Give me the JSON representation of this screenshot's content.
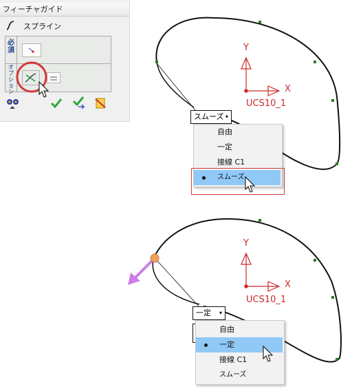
{
  "guide": {
    "title": "フィーチャガイド",
    "feature_label": "スプライン",
    "section_required": "必須",
    "section_option": "オプション"
  },
  "canvas1": {
    "combo_value": "スムーズ",
    "menu_items": [
      "自由",
      "一定",
      "接線 C1",
      "スムーズ"
    ],
    "selected_index": 3
  },
  "canvas2": {
    "combo_value": "一定",
    "menu_items": [
      "自由",
      "一定",
      "接線 C1",
      "スムーズ"
    ],
    "selected_index": 1
  },
  "ucs": {
    "axis_y": "Y",
    "axis_x": "X",
    "name": "UCS10_1"
  },
  "colors": {
    "selection_blue": "#90c8f6",
    "ucs_red": "#cc2a2a",
    "highlight_red": "#d43b3b",
    "vector_violet": "#cc7ee8",
    "handle_orange": "#f0a060"
  },
  "icons": [
    "spline-icon",
    "point-icon",
    "tangent-option-icon",
    "list-icon",
    "preview-icon",
    "ok-check-icon",
    "apply-icon",
    "cancel-icon"
  ]
}
